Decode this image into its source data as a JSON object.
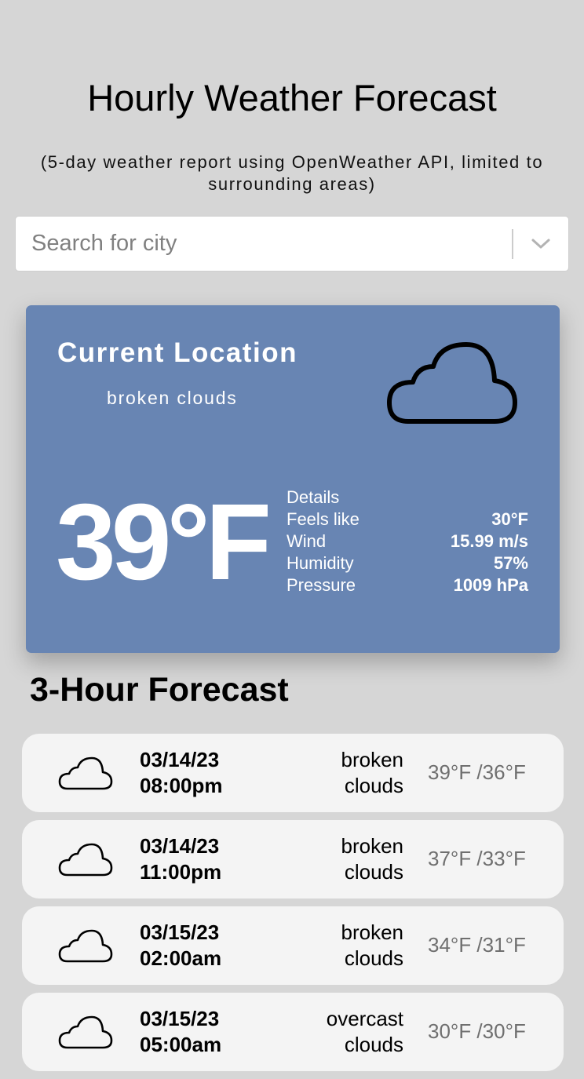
{
  "header": {
    "title": "Hourly Weather Forecast",
    "subtitle": "(5-day weather report using OpenWeather API, limited to surrounding areas)"
  },
  "search": {
    "placeholder": "Search for city",
    "value": ""
  },
  "current": {
    "city": "Current Location",
    "description": "broken clouds",
    "temperature": "39°F",
    "icon": "cloud-icon",
    "details_label": "Details",
    "details": [
      {
        "label": "Feels like",
        "value": "30°F"
      },
      {
        "label": "Wind",
        "value": "15.99 m/s"
      },
      {
        "label": "Humidity",
        "value": "57%"
      },
      {
        "label": "Pressure",
        "value": "1009 hPa"
      }
    ]
  },
  "forecast": {
    "title": "3-Hour Forecast",
    "items": [
      {
        "date": "03/14/23",
        "time": "08:00pm",
        "desc_line1": "broken",
        "desc_line2": "clouds",
        "temp": "39°F /36°F",
        "icon": "cloud-icon"
      },
      {
        "date": "03/14/23",
        "time": "11:00pm",
        "desc_line1": "broken",
        "desc_line2": "clouds",
        "temp": "37°F /33°F",
        "icon": "cloud-icon"
      },
      {
        "date": "03/15/23",
        "time": "02:00am",
        "desc_line1": "broken",
        "desc_line2": "clouds",
        "temp": "34°F /31°F",
        "icon": "cloud-icon"
      },
      {
        "date": "03/15/23",
        "time": "05:00am",
        "desc_line1": "overcast",
        "desc_line2": "clouds",
        "temp": "30°F /30°F",
        "icon": "cloud-icon"
      }
    ]
  },
  "colors": {
    "background": "#d6d6d6",
    "card": "#6885b3",
    "forecast_item": "#f4f4f4",
    "forecast_temp": "#6f6f6f"
  }
}
